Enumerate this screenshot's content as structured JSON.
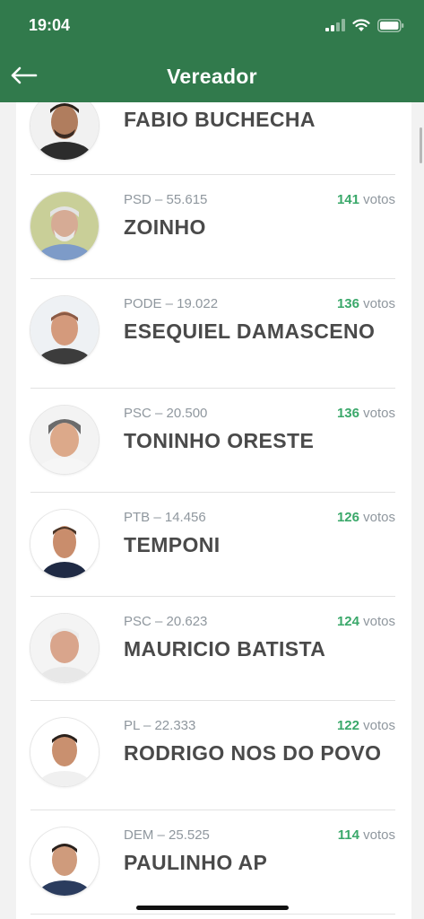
{
  "status_bar": {
    "time": "19:04"
  },
  "header": {
    "title": "Vereador"
  },
  "votes_suffix": "votos",
  "candidates": [
    {
      "party": "",
      "name": "FABIO BUCHECHA",
      "votes": ""
    },
    {
      "party": "PSD – 55.615",
      "name": "ZOINHO",
      "votes": "141"
    },
    {
      "party": "PODE – 19.022",
      "name": "ESEQUIEL DAMASCENO",
      "votes": "136"
    },
    {
      "party": "PSC – 20.500",
      "name": "TONINHO ORESTE",
      "votes": "136"
    },
    {
      "party": "PTB – 14.456",
      "name": "TEMPONI",
      "votes": "126"
    },
    {
      "party": "PSC – 20.623",
      "name": "MAURICIO BATISTA",
      "votes": "124"
    },
    {
      "party": "PL – 22.333",
      "name": "RODRIGO NOS DO POVO",
      "votes": "122"
    },
    {
      "party": "DEM – 25.525",
      "name": "PAULINHO AP",
      "votes": "114"
    }
  ]
}
